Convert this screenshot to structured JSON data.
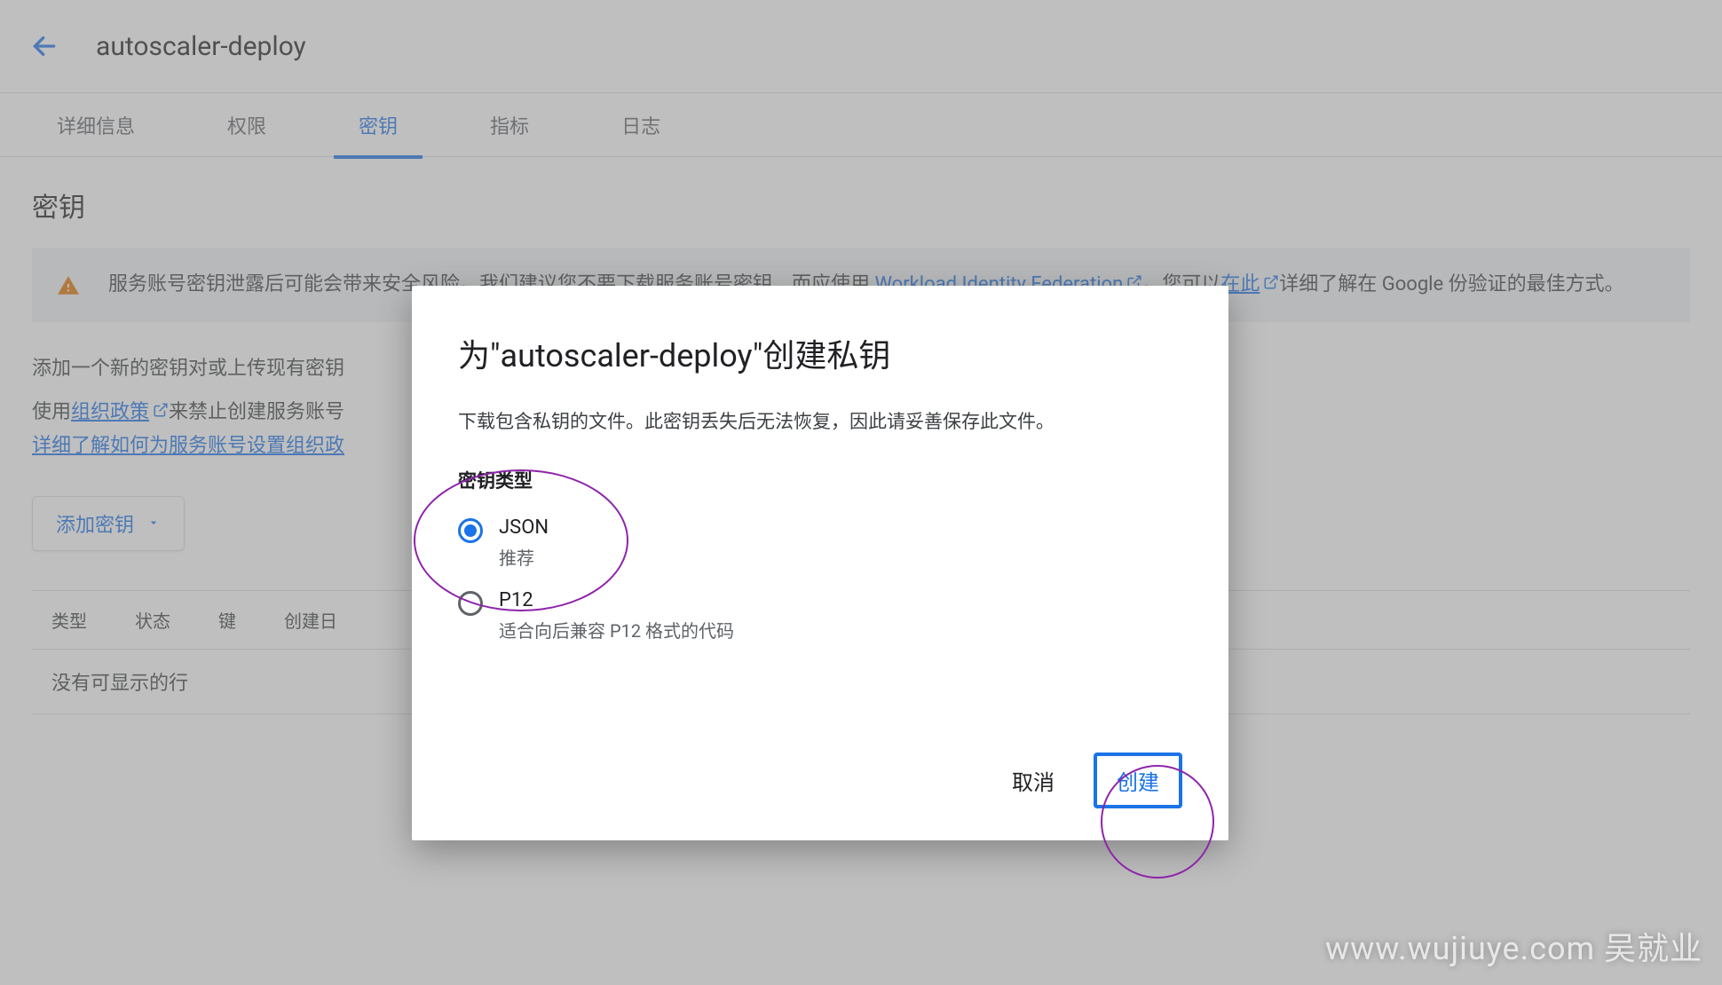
{
  "header": {
    "title": "autoscaler-deploy"
  },
  "tabs": [
    {
      "label": "详细信息"
    },
    {
      "label": "权限"
    },
    {
      "label": "密钥"
    },
    {
      "label": "指标"
    },
    {
      "label": "日志"
    }
  ],
  "section_title": "密钥",
  "warning": {
    "prefix": "服务账号密钥泄露后可能会带来安全风险。我们建议您不要下载服务账号密钥，而应使用 ",
    "link1": "Workload Identity Federation",
    "mid": "。您可以",
    "link2": "在此",
    "suffix": "详细了解在 Google 份验证的最佳方式。"
  },
  "para1": "添加一个新的密钥对或上传现有密钥",
  "para2": {
    "t1": "使用",
    "link1": "组织政策",
    "t2": "来禁止创建服务账号",
    "link2": "详细了解如何为服务账号设置组织政"
  },
  "add_key_button": "添加密钥",
  "table": {
    "headers": [
      "类型",
      "状态",
      "键",
      "创建日"
    ],
    "empty": "没有可显示的行"
  },
  "dialog": {
    "title": "为\"autoscaler-deploy\"创建私钥",
    "desc": "下载包含私钥的文件。此密钥丢失后无法恢复，因此请妥善保存此文件。",
    "field_label": "密钥类型",
    "options": [
      {
        "label": "JSON",
        "sub": "推荐",
        "selected": true
      },
      {
        "label": "P12",
        "sub": "适合向后兼容 P12 格式的代码",
        "selected": false
      }
    ],
    "cancel": "取消",
    "create": "创建"
  },
  "watermark": "www.wujiuye.com 吴就业"
}
